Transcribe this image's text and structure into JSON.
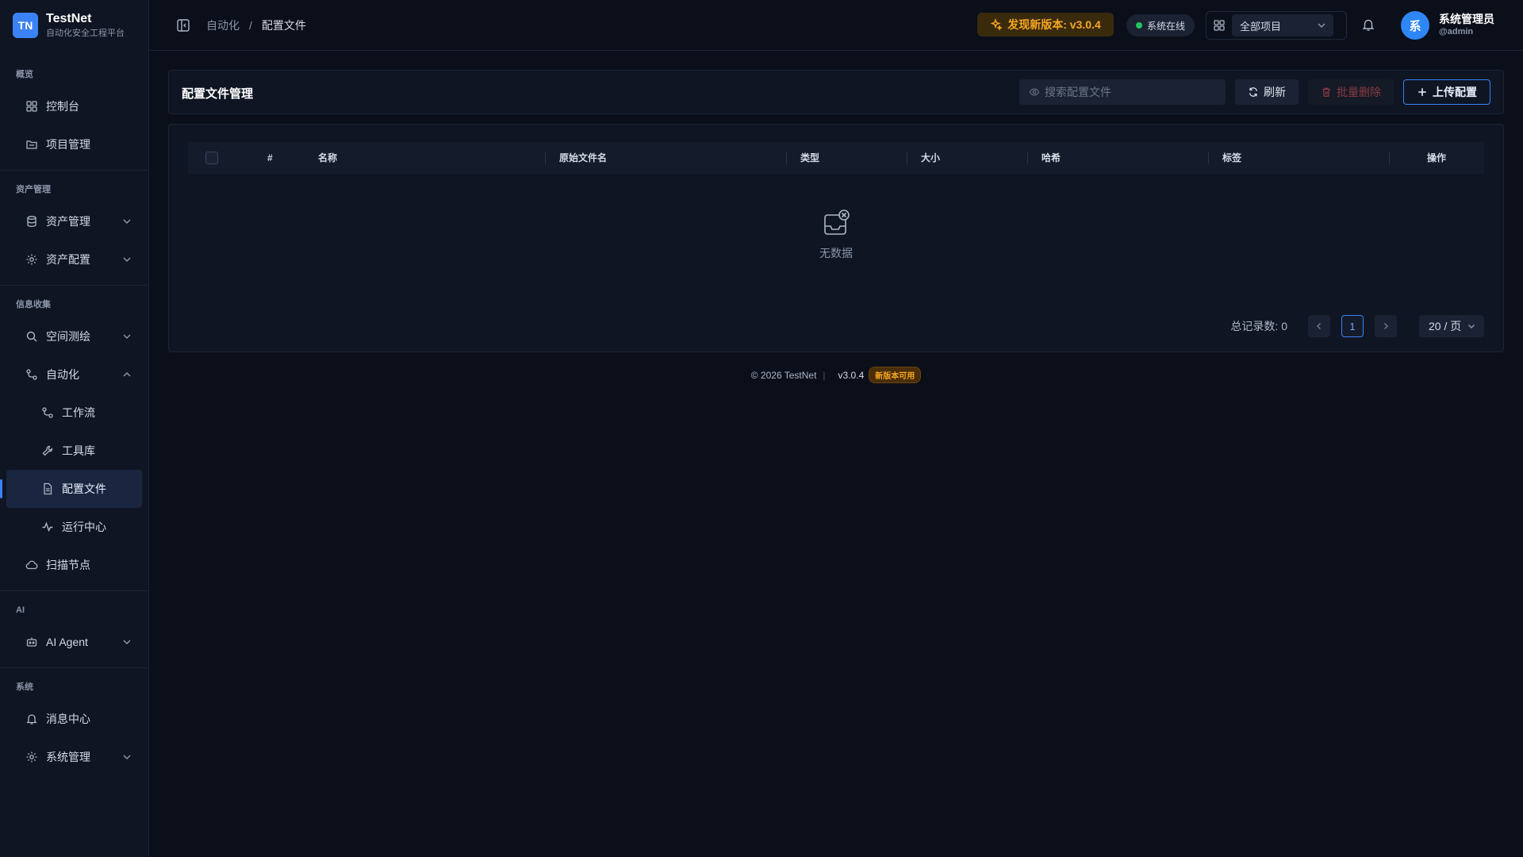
{
  "brand": {
    "logo": "TN",
    "title": "TestNet",
    "subtitle": "自动化安全工程平台"
  },
  "sidebar": {
    "sections": {
      "overview": "概览",
      "assets": "资产管理",
      "recon": "信息收集",
      "ai": "AI",
      "system": "系统"
    },
    "items": {
      "dashboard": "控制台",
      "projects": "项目管理",
      "asset_mgmt": "资产管理",
      "asset_config": "资产配置",
      "space_mapping": "空间测绘",
      "automation": "自动化",
      "workflow": "工作流",
      "toolbox": "工具库",
      "config_files": "配置文件",
      "run_center": "运行中心",
      "scan_nodes": "扫描节点",
      "ai_agent": "AI Agent",
      "messages": "消息中心",
      "system_mgmt": "系统管理"
    }
  },
  "header": {
    "breadcrumb": [
      "自动化",
      "配置文件"
    ],
    "breadcrumb_sep": "/",
    "update_badge": "发现新版本: v3.0.4",
    "status": "系统在线",
    "project_select": "全部项目",
    "user": {
      "avatar": "系",
      "name": "系统管理员",
      "handle": "@admin"
    }
  },
  "main": {
    "title": "配置文件管理",
    "search_placeholder": "搜索配置文件",
    "buttons": {
      "refresh": "刷新",
      "batch_delete": "批量删除",
      "upload": "上传配置"
    },
    "columns": [
      "#",
      "名称",
      "原始文件名",
      "类型",
      "大小",
      "哈希",
      "标签",
      "操作"
    ],
    "rows": [],
    "empty_text": "无数据",
    "pagination": {
      "total": "总记录数: 0",
      "current_page": "1",
      "page_size": "20 / 页"
    }
  },
  "footer": {
    "copyright": "© 2026 TestNet",
    "version": "v3.0.4",
    "new_badge": "新版本可用"
  },
  "colors": {
    "accent": "#3b82f6",
    "warning": "#f5a623",
    "online": "#22c55e",
    "danger": "#8a3a44"
  }
}
